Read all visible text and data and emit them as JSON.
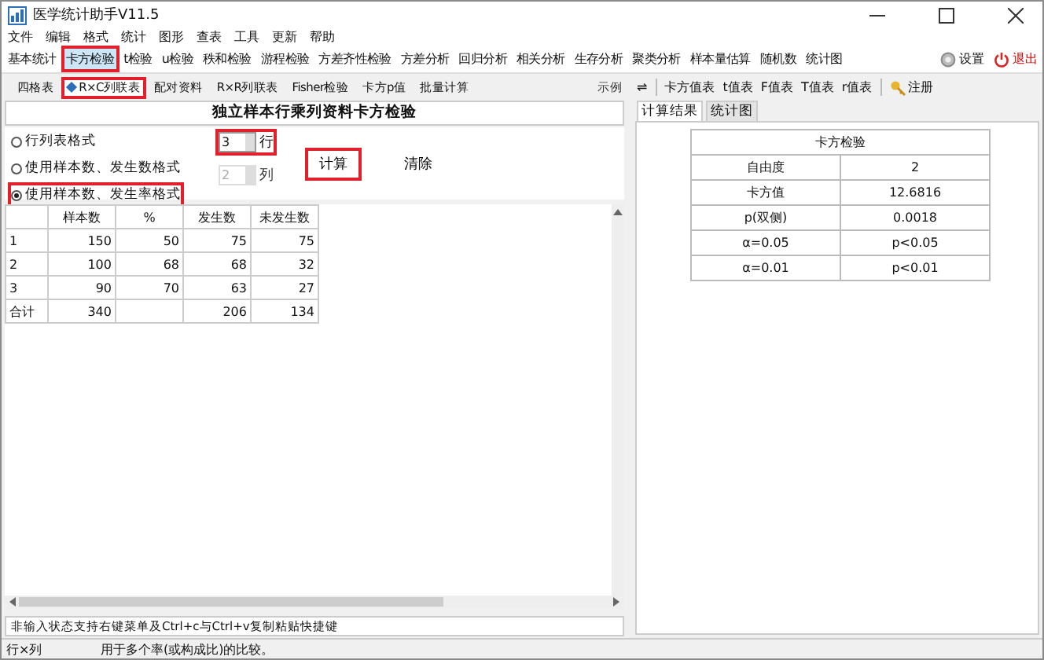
{
  "window": {
    "title": "医学统计助手V11.5"
  },
  "menu": [
    "文件",
    "编辑",
    "格式",
    "统计",
    "图形",
    "查表",
    "工具",
    "更新",
    "帮助"
  ],
  "main_tabs": [
    {
      "label": "基本统计",
      "selected": false,
      "highlighted": false
    },
    {
      "label": "卡方检验",
      "selected": true,
      "highlighted": true
    },
    {
      "label": "t检验",
      "selected": false,
      "highlighted": false
    },
    {
      "label": "u检验",
      "selected": false,
      "highlighted": false
    },
    {
      "label": "秩和检验",
      "selected": false,
      "highlighted": false
    },
    {
      "label": "游程检验",
      "selected": false,
      "highlighted": false
    },
    {
      "label": "方差齐性检验",
      "selected": false,
      "highlighted": false
    },
    {
      "label": "方差分析",
      "selected": false,
      "highlighted": false
    },
    {
      "label": "回归分析",
      "selected": false,
      "highlighted": false
    },
    {
      "label": "相关分析",
      "selected": false,
      "highlighted": false
    },
    {
      "label": "生存分析",
      "selected": false,
      "highlighted": false
    },
    {
      "label": "聚类分析",
      "selected": false,
      "highlighted": false
    },
    {
      "label": "样本量估算",
      "selected": false,
      "highlighted": false
    },
    {
      "label": "随机数",
      "selected": false,
      "highlighted": false
    },
    {
      "label": "统计图",
      "selected": false,
      "highlighted": false
    }
  ],
  "actions": [
    {
      "kind": "settings",
      "label": "设置"
    },
    {
      "kind": "exit",
      "label": "退出"
    }
  ],
  "sub_tabs": [
    {
      "label": "四格表",
      "selected": false,
      "highlighted": false
    },
    {
      "label": "R×C列联表",
      "selected": true,
      "highlighted": true
    },
    {
      "label": "配对资料",
      "selected": false,
      "highlighted": false
    },
    {
      "label": "R×R列联表",
      "selected": false,
      "highlighted": false
    },
    {
      "label": "Fisher检验",
      "selected": false,
      "highlighted": false
    },
    {
      "label": "卡方p值",
      "selected": false,
      "highlighted": false
    },
    {
      "label": "批量计算",
      "selected": false,
      "highlighted": false
    }
  ],
  "example": "示例",
  "heading": "独立样本行乘列资料卡方检验",
  "formats": [
    {
      "label": "行列表格式",
      "selected": false,
      "highlighted": false
    },
    {
      "label": "使用样本数、发生数格式",
      "selected": false,
      "highlighted": false
    },
    {
      "label": "使用样本数、发生率格式",
      "selected": true,
      "highlighted": true
    }
  ],
  "spinners": [
    {
      "value": "3",
      "unit": "行",
      "disabled": false,
      "highlighted": true
    },
    {
      "value": "2",
      "unit": "列",
      "disabled": true,
      "highlighted": false
    }
  ],
  "buttons": [
    {
      "label": "计算",
      "highlighted": true
    },
    {
      "label": "清除",
      "highlighted": false
    }
  ],
  "grid": {
    "columns": [
      null,
      "样本数",
      "%",
      "发生数",
      "未发生数"
    ],
    "rows": [
      [
        "1",
        "150",
        "50",
        "75",
        "75"
      ],
      [
        "2",
        "100",
        "68",
        "68",
        "32"
      ],
      [
        "3",
        "90",
        "70",
        "63",
        "27"
      ],
      [
        "合计",
        "340",
        null,
        "206",
        "134"
      ]
    ]
  },
  "note": "非输入状态支持右键菜单及Ctrl+c与Ctrl+v复制粘贴快捷键",
  "table_tools": [
    {
      "kind": "swap",
      "label": "⇌"
    },
    {
      "kind": "text",
      "label": "卡方值表"
    },
    {
      "kind": "text",
      "label": "t值表"
    },
    {
      "kind": "text",
      "label": "F值表"
    },
    {
      "kind": "text",
      "label": "T值表"
    },
    {
      "kind": "text",
      "label": "r值表"
    },
    {
      "kind": "register",
      "label": "注册"
    }
  ],
  "result_tabs": [
    {
      "label": "计算结果",
      "selected": true
    },
    {
      "label": "统计图",
      "selected": false
    }
  ],
  "result_table": {
    "title": "卡方检验",
    "rows": [
      [
        "自由度",
        "2"
      ],
      [
        "卡方值",
        "12.6816"
      ],
      [
        "p(双侧)",
        "0.0018"
      ],
      [
        "α=0.05",
        "p<0.05"
      ],
      [
        "α=0.01",
        "p<0.01"
      ]
    ]
  },
  "status_bar": [
    "行×列",
    "用于多个率(或构成比)的比较。"
  ]
}
